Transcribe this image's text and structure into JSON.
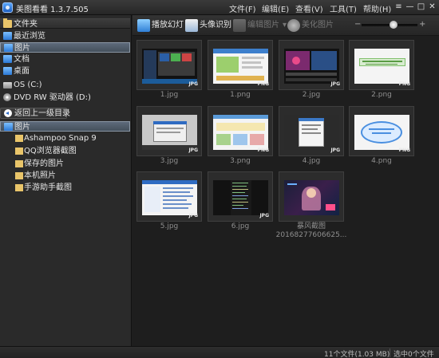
{
  "window": {
    "title": "美图看看 1.3.7.505"
  },
  "menu": [
    "文件(F)",
    "编辑(E)",
    "查看(V)",
    "工具(T)",
    "帮助(H)"
  ],
  "window_controls": {
    "menu": "≡",
    "minimize": "—",
    "maximize": "□",
    "close": "✕"
  },
  "sidebar": {
    "favorites_header": "文件夹",
    "items": [
      {
        "label": "最近浏览",
        "icon": "recent-icon"
      },
      {
        "label": "图片",
        "icon": "pictures-folder-icon",
        "selected": true
      },
      {
        "label": "文档",
        "icon": "documents-icon"
      },
      {
        "label": "桌面",
        "icon": "desktop-icon"
      }
    ],
    "drives": [
      {
        "label": "OS (C:)",
        "icon": "hard-drive-icon"
      },
      {
        "label": "DVD RW 驱动器 (D:)",
        "icon": "dvd-drive-icon"
      }
    ],
    "back_label": "返回上一级目录",
    "current_folder": "图片",
    "subfolders": [
      "Ashampoo Snap 9",
      "QQ浏览器截图",
      "保存的图片",
      "本机照片",
      "手游助手截图"
    ]
  },
  "toolbar": {
    "slideshow": "播放幻灯",
    "face_recognition": "头像识别",
    "edit_image": "编辑图片",
    "beautify_image": "美化图片",
    "zoom_minus": "−",
    "zoom_plus": "+"
  },
  "zoom_level": 0.5,
  "files": [
    {
      "name": "1.jpg",
      "format": "JPG",
      "icon": "thumbnail-dark-desktop"
    },
    {
      "name": "1.png",
      "format": "PNG",
      "icon": "thumbnail-webpage"
    },
    {
      "name": "2.jpg",
      "format": "JPG",
      "icon": "thumbnail-dark-app"
    },
    {
      "name": "2.png",
      "format": "PNG",
      "icon": "thumbnail-green-banner"
    },
    {
      "name": "3.jpg",
      "format": "JPG",
      "icon": "thumbnail-dialog"
    },
    {
      "name": "3.png",
      "format": "PNG",
      "icon": "thumbnail-webpage"
    },
    {
      "name": "4.jpg",
      "format": "JPG",
      "icon": "thumbnail-popup"
    },
    {
      "name": "4.png",
      "format": "PNG",
      "icon": "thumbnail-blue-oval"
    },
    {
      "name": "5.jpg",
      "format": "JPG",
      "icon": "thumbnail-file-list"
    },
    {
      "name": "6.jpg",
      "format": "JPG",
      "icon": "thumbnail-code-list"
    },
    {
      "name": "暴风截图\n20168277606625...",
      "format": "",
      "icon": "thumbnail-video-frame"
    }
  ],
  "status": {
    "file_count": "11个文件(1.03 MB)",
    "selected": "选中0个文件"
  }
}
